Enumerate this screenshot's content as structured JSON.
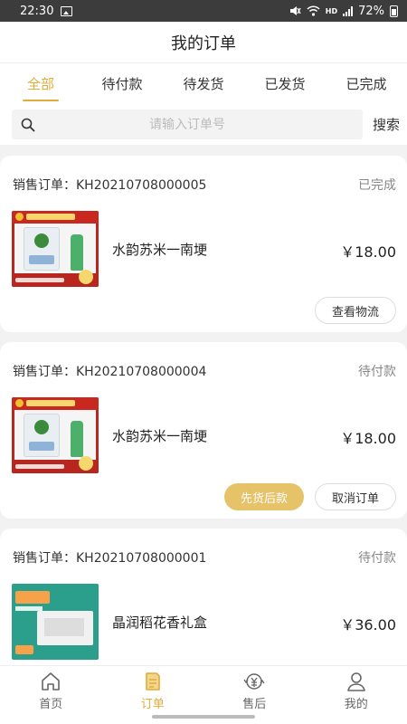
{
  "status_bar": {
    "time": "22:30",
    "battery": "72%",
    "network": "HD"
  },
  "header": {
    "title": "我的订单"
  },
  "tabs": [
    {
      "label": "全部",
      "active": true
    },
    {
      "label": "待付款",
      "active": false
    },
    {
      "label": "待发货",
      "active": false
    },
    {
      "label": "已发货",
      "active": false
    },
    {
      "label": "已完成",
      "active": false
    }
  ],
  "search": {
    "placeholder": "请输入订单号",
    "value": "",
    "button_label": "搜索"
  },
  "orders": [
    {
      "order_no": "销售订单：KH20210708000005",
      "status": "已完成",
      "product_name": "水韵苏米一南埂",
      "price": "￥18.00",
      "actions": [
        "查看物流"
      ]
    },
    {
      "order_no": "销售订单：KH20210708000004",
      "status": "待付款",
      "product_name": "水韵苏米一南埂",
      "price": "￥18.00",
      "actions": [
        "先货后款",
        "取消订单"
      ]
    },
    {
      "order_no": "销售订单：KH20210708000001",
      "status": "待付款",
      "product_name": "晶润稻花香礼盒",
      "price": "￥36.00",
      "actions": []
    }
  ],
  "bottom_nav": [
    {
      "label": "首页",
      "icon": "home-icon",
      "active": false
    },
    {
      "label": "订单",
      "icon": "order-icon",
      "active": true
    },
    {
      "label": "售后",
      "icon": "after-sales-icon",
      "active": false
    },
    {
      "label": "我的",
      "icon": "profile-icon",
      "active": false
    }
  ],
  "colors": {
    "accent": "#e0ac3a",
    "primary_button": "#e6c268",
    "background": "#f2f2f2"
  }
}
